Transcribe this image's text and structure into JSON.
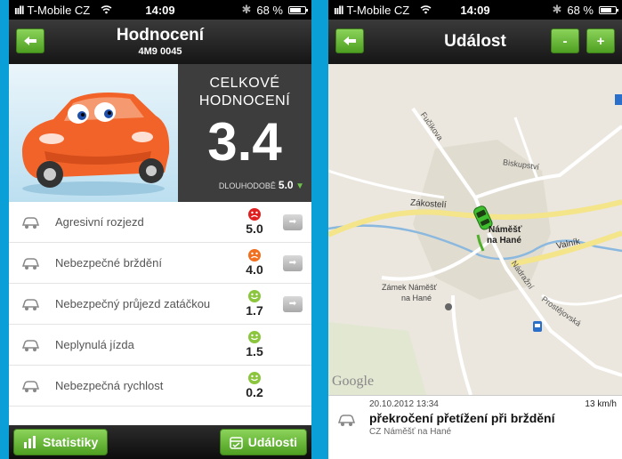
{
  "left": {
    "status": {
      "carrier": "T-Mobile CZ",
      "time": "14:09",
      "battery": "68 %",
      "battery_level": 0.68
    },
    "nav": {
      "title": "Hodnocení",
      "subtitle": "4M9 0045",
      "back_icon": "arrow-left-icon"
    },
    "score": {
      "label_line1": "CELKOVÉ",
      "label_line2": "HODNOCENÍ",
      "value": "3.4",
      "longterm_label": "DLOUHODOBĚ",
      "longterm_value": "5.0",
      "trend_icon": "triangle-down-icon"
    },
    "metrics": [
      {
        "label": "Agresivní rozjezd",
        "value": "5.0",
        "face_color": "#e02020",
        "mood": "sad",
        "has_arrow": true,
        "icon": "car-start-icon"
      },
      {
        "label": "Nebezpečné brždění",
        "value": "4.0",
        "face_color": "#f07020",
        "mood": "sad",
        "has_arrow": true,
        "icon": "brake-disc-icon"
      },
      {
        "label": "Nebezpečný průjezd zatáčkou",
        "value": "1.7",
        "face_color": "#8cc63f",
        "mood": "happy",
        "has_arrow": true,
        "icon": "car-turn-icon"
      },
      {
        "label": "Neplynulá jízda",
        "value": "1.5",
        "face_color": "#8cc63f",
        "mood": "happy",
        "has_arrow": false,
        "icon": "jerky-ride-icon"
      },
      {
        "label": "Nebezpečná rychlost",
        "value": "0.2",
        "face_color": "#8cc63f",
        "mood": "happy",
        "has_arrow": false,
        "icon": "speedometer-icon"
      }
    ],
    "bottom": {
      "stats_label": "Statistiky",
      "events_label": "Události"
    }
  },
  "right": {
    "status": {
      "carrier": "T-Mobile CZ",
      "time": "14:09",
      "battery": "68 %",
      "battery_level": 0.68
    },
    "nav": {
      "title": "Událost",
      "minus": "-",
      "plus": "+"
    },
    "map": {
      "labels": {
        "fucikova": "Fučíkova",
        "biskupstvi": "Biskupství",
        "zakosteli": "Zákostelí",
        "namest": "Náměšť",
        "nahane": "na Hané",
        "valnik": "Valník",
        "nadrazni": "Nádražní",
        "prostejovska": "Prostějovská",
        "zamek1": "Zámek Náměšť",
        "zamek2": "na Hané",
        "google": "Google"
      }
    },
    "event": {
      "date": "20.10.2012 13:34",
      "speed": "13 km/h",
      "title": "překročení přetížení při brždění",
      "location": "CZ Náměšť na Hané"
    }
  }
}
